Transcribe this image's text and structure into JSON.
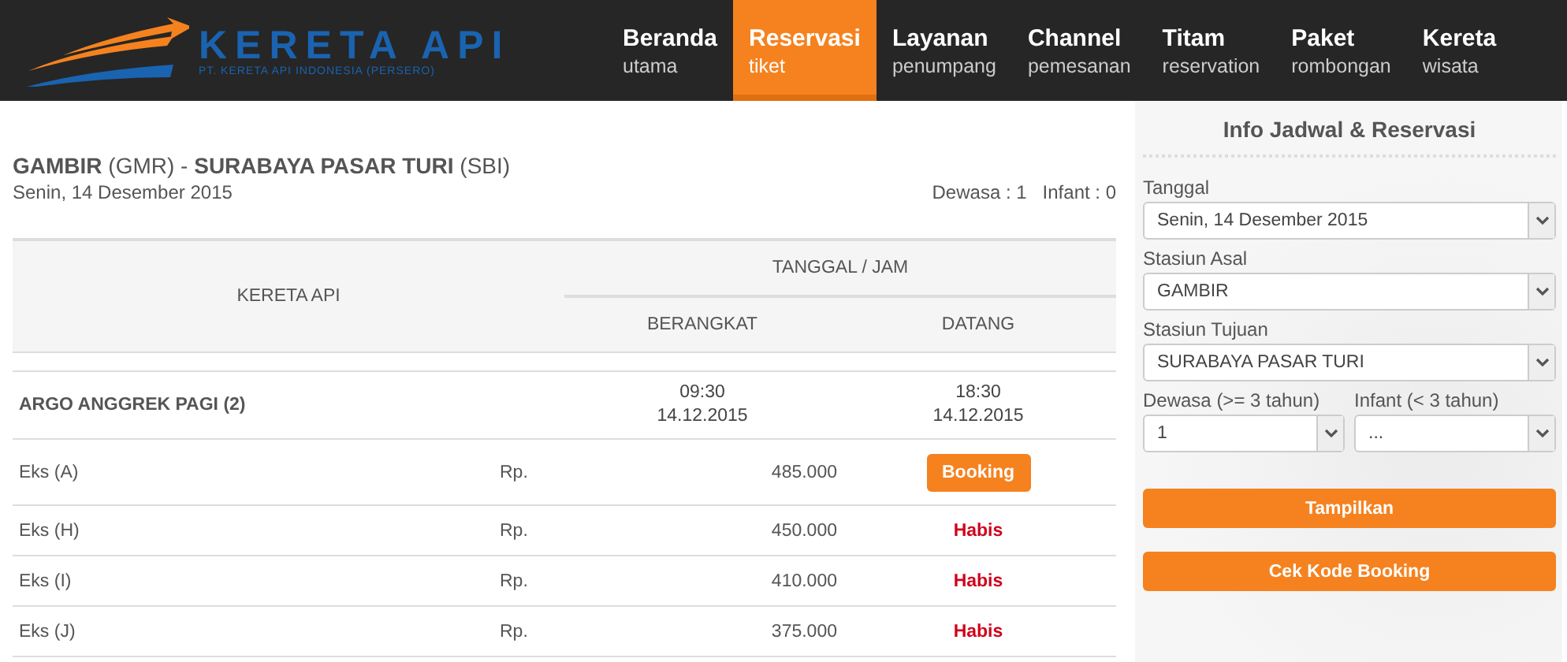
{
  "logo": {
    "name": "KERETA API",
    "subtitle": "PT. KERETA API INDONESIA (PERSERO)"
  },
  "nav": [
    {
      "title": "Beranda",
      "subtitle": "utama",
      "selected": false
    },
    {
      "title": "Reservasi",
      "subtitle": "tiket",
      "selected": true
    },
    {
      "title": "Layanan",
      "subtitle": "penumpang",
      "selected": false
    },
    {
      "title": "Channel",
      "subtitle": "pemesanan",
      "selected": false
    },
    {
      "title": "Titam",
      "subtitle": "reservation",
      "selected": false
    },
    {
      "title": "Paket",
      "subtitle": "rombongan",
      "selected": false
    },
    {
      "title": "Kereta",
      "subtitle": "wisata",
      "selected": false
    }
  ],
  "route": {
    "heading": "**GAMBIR** (GMR) - **SURABAYA PASAR TURI** (SBI)",
    "date": "Senin, 14 Desember 2015",
    "adults": "Dewasa : 1",
    "infants": "Infant : 0"
  },
  "table": {
    "columns": {
      "train": "KERETA API",
      "group": "TANGGAL / JAM",
      "depart": "BERANGKAT",
      "arrive": "DATANG"
    },
    "train": {
      "name": "ARGO ANGGREK PAGI (2)",
      "depart_time": "09:30",
      "depart_date": "14.12.2015",
      "arrive_time": "18:30",
      "arrive_date": "14.12.2015"
    },
    "fares": [
      {
        "class": "Eks (A)",
        "currency": "Rp.",
        "price": "485.000",
        "kind": "button",
        "action": "Booking"
      },
      {
        "class": "Eks (H)",
        "currency": "Rp.",
        "price": "450.000",
        "kind": "sold_out",
        "action": "Habis"
      },
      {
        "class": "Eks (I)",
        "currency": "Rp.",
        "price": "410.000",
        "kind": "sold_out",
        "action": "Habis"
      },
      {
        "class": "Eks (J)",
        "currency": "Rp.",
        "price": "375.000",
        "kind": "sold_out",
        "action": "Habis"
      }
    ]
  },
  "panel": {
    "title": "Info Jadwal & Reservasi",
    "fields": [
      {
        "label": "Tanggal",
        "value": "Senin, 14 Desember 2015"
      },
      {
        "label": "Stasiun Asal",
        "value": "GAMBIR"
      },
      {
        "label": "Stasiun Tujuan",
        "value": "SURABAYA PASAR TURI"
      }
    ],
    "passenger_fields": [
      {
        "label": "Dewasa (>= 3 tahun)",
        "value": "1"
      },
      {
        "label": "Infant (< 3 tahun)",
        "value": "..."
      }
    ],
    "buttons": [
      "Tampilkan",
      "Cek Kode Booking"
    ]
  }
}
